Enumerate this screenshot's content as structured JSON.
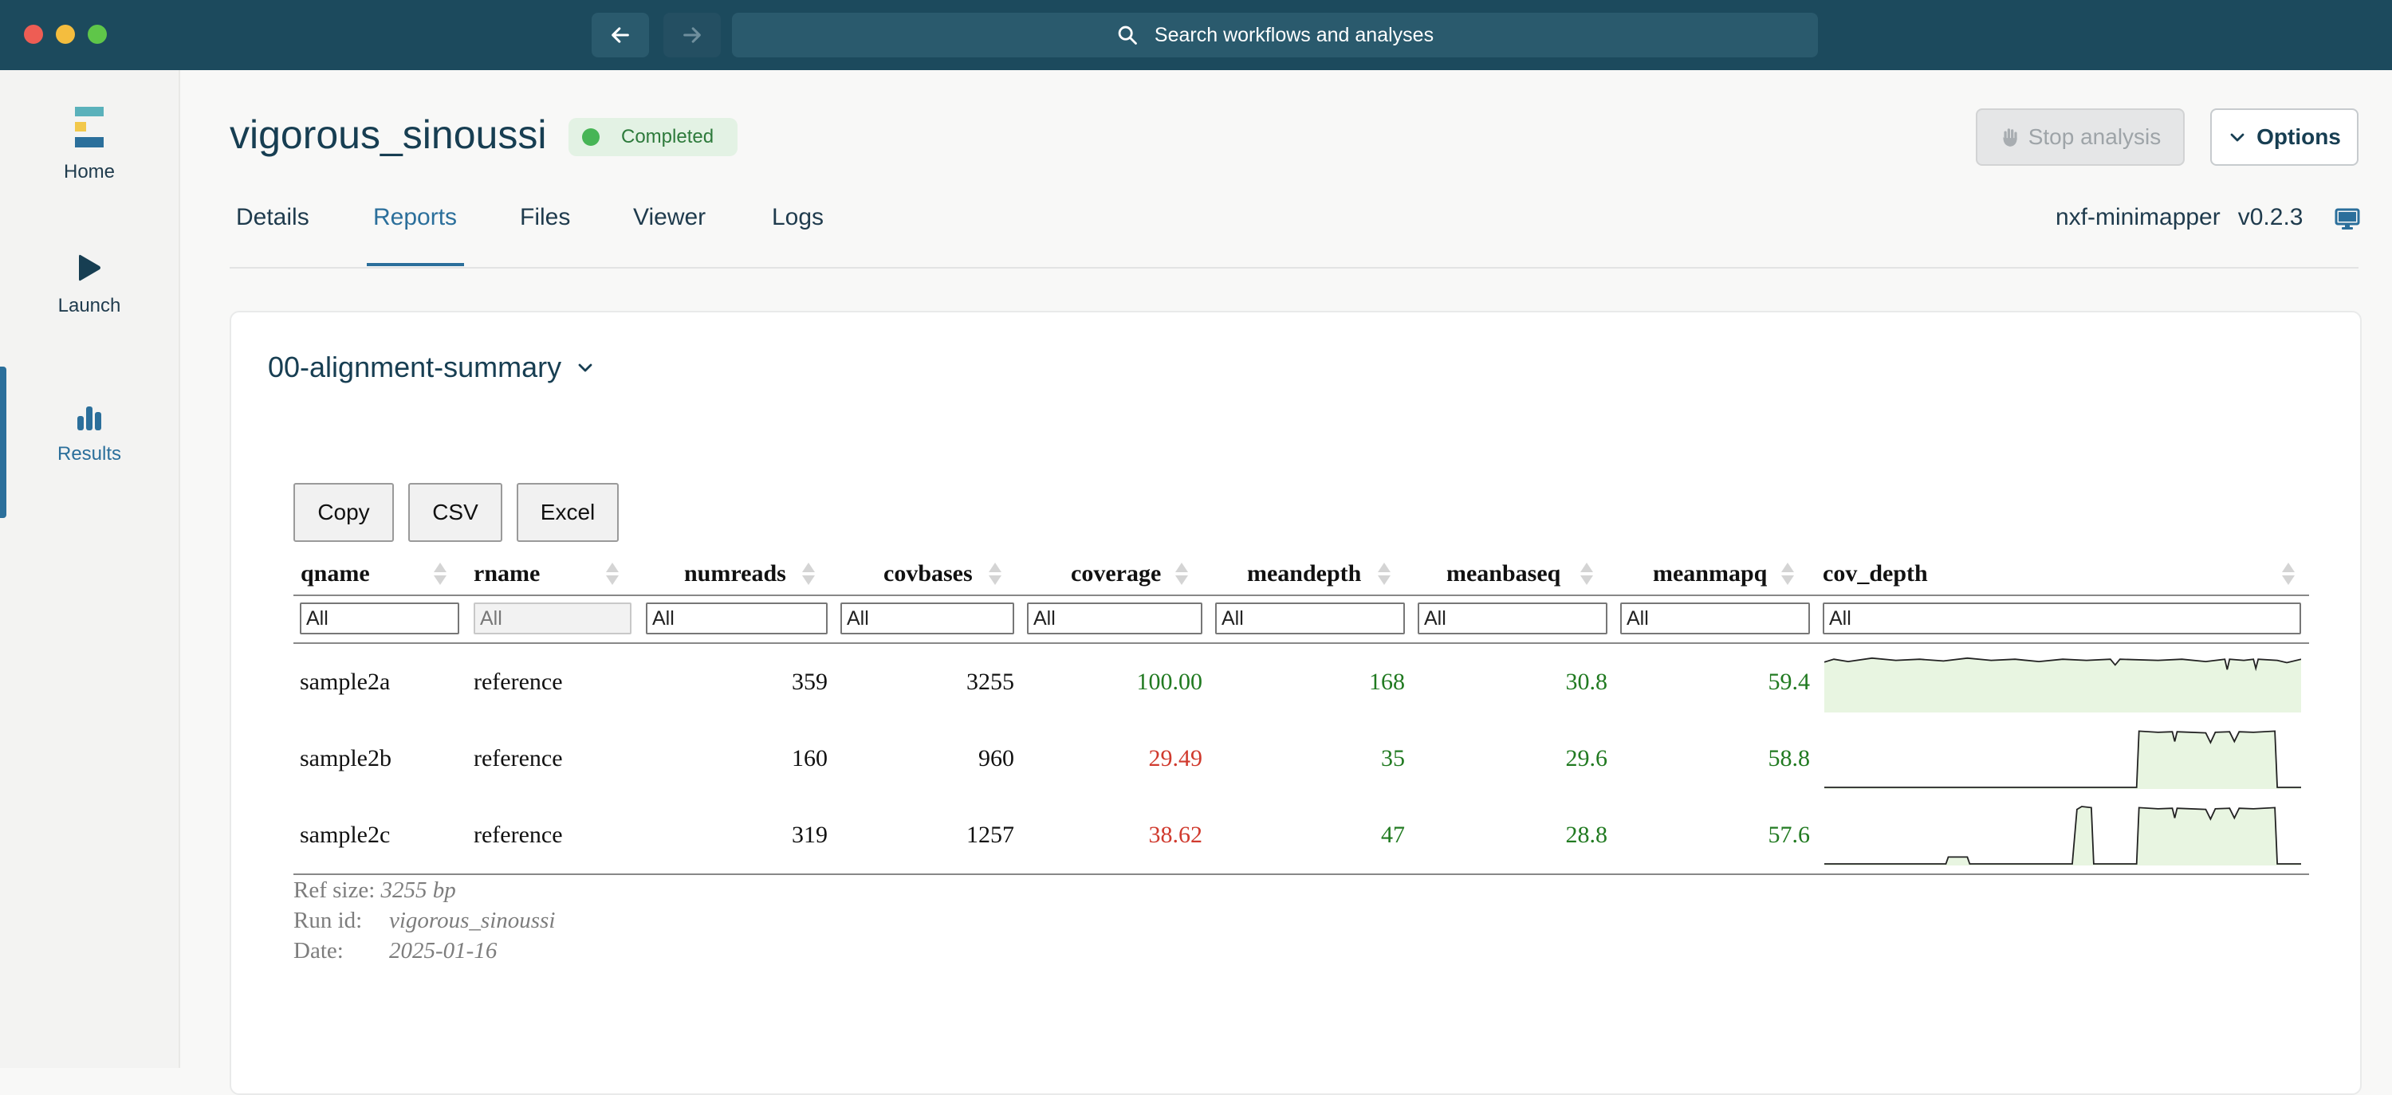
{
  "titlebar": {
    "search_placeholder": "Search workflows and analyses",
    "icons": {
      "back": "arrow-left-icon",
      "forward": "arrow-right-icon",
      "search": "search-icon"
    }
  },
  "sidebar": {
    "items": [
      {
        "label": "Home",
        "icon": "logo-icon"
      },
      {
        "label": "Launch",
        "icon": "play-icon"
      },
      {
        "label": "Results",
        "icon": "bar-chart-icon",
        "active": true
      }
    ]
  },
  "header": {
    "title": "vigorous_sinoussi",
    "status": "Completed",
    "stop_label": "Stop analysis",
    "options_label": "Options"
  },
  "tabs": [
    {
      "label": "Details"
    },
    {
      "label": "Reports",
      "active": true
    },
    {
      "label": "Files"
    },
    {
      "label": "Viewer"
    },
    {
      "label": "Logs"
    }
  ],
  "pipeline": {
    "name": "nxf-minimapper",
    "version": "v0.2.3"
  },
  "report": {
    "selected": "00-alignment-summary",
    "export_buttons": [
      "Copy",
      "CSV",
      "Excel"
    ],
    "columns": [
      "qname",
      "rname",
      "numreads",
      "covbases",
      "coverage",
      "meandepth",
      "meanbaseq",
      "meanmapq",
      "cov_depth"
    ],
    "filter_placeholder": "All",
    "rows": [
      {
        "qname": "sample2a",
        "rname": "reference",
        "numreads": "359",
        "covbases": "3255",
        "coverage": "100.00",
        "meandepth": "168",
        "meanbaseq": "30.8",
        "meanmapq": "59.4",
        "cov_depth": [
          [
            0,
            0.85
          ],
          [
            0.02,
            0.9
          ],
          [
            0.05,
            0.86
          ],
          [
            0.1,
            0.92
          ],
          [
            0.15,
            0.88
          ],
          [
            0.2,
            0.9
          ],
          [
            0.25,
            0.87
          ],
          [
            0.3,
            0.92
          ],
          [
            0.35,
            0.88
          ],
          [
            0.4,
            0.9
          ],
          [
            0.45,
            0.86
          ],
          [
            0.5,
            0.9
          ],
          [
            0.55,
            0.88
          ],
          [
            0.6,
            0.9
          ],
          [
            0.61,
            0.8
          ],
          [
            0.62,
            0.9
          ],
          [
            0.7,
            0.88
          ],
          [
            0.75,
            0.9
          ],
          [
            0.8,
            0.86
          ],
          [
            0.84,
            0.9
          ],
          [
            0.845,
            0.72
          ],
          [
            0.85,
            0.9
          ],
          [
            0.88,
            0.88
          ],
          [
            0.9,
            0.9
          ],
          [
            0.905,
            0.74
          ],
          [
            0.91,
            0.9
          ],
          [
            0.95,
            0.88
          ],
          [
            0.97,
            0.84
          ],
          [
            1,
            0.9
          ]
        ]
      },
      {
        "qname": "sample2b",
        "rname": "reference",
        "numreads": "160",
        "covbases": "960",
        "coverage": "29.49",
        "meandepth": "35",
        "meanbaseq": "29.6",
        "meanmapq": "58.8",
        "cov_depth": [
          [
            0,
            0
          ],
          [
            0.655,
            0
          ],
          [
            0.66,
            0.98
          ],
          [
            0.7,
            0.96
          ],
          [
            0.73,
            0.97
          ],
          [
            0.735,
            0.8
          ],
          [
            0.74,
            0.97
          ],
          [
            0.8,
            0.95
          ],
          [
            0.81,
            0.78
          ],
          [
            0.82,
            0.96
          ],
          [
            0.85,
            0.97
          ],
          [
            0.86,
            0.8
          ],
          [
            0.87,
            0.97
          ],
          [
            0.9,
            0.96
          ],
          [
            0.945,
            0.98
          ],
          [
            0.95,
            0
          ],
          [
            1,
            0
          ]
        ]
      },
      {
        "qname": "sample2c",
        "rname": "reference",
        "numreads": "319",
        "covbases": "1257",
        "coverage": "38.62",
        "meandepth": "47",
        "meanbaseq": "28.8",
        "meanmapq": "57.6",
        "cov_depth": [
          [
            0,
            0
          ],
          [
            0.255,
            0
          ],
          [
            0.26,
            0.12
          ],
          [
            0.3,
            0.12
          ],
          [
            0.305,
            0
          ],
          [
            0.52,
            0
          ],
          [
            0.53,
            0.95
          ],
          [
            0.54,
            1
          ],
          [
            0.56,
            0.98
          ],
          [
            0.565,
            0
          ],
          [
            0.655,
            0
          ],
          [
            0.66,
            0.98
          ],
          [
            0.7,
            0.96
          ],
          [
            0.73,
            0.97
          ],
          [
            0.735,
            0.8
          ],
          [
            0.74,
            0.97
          ],
          [
            0.8,
            0.95
          ],
          [
            0.81,
            0.78
          ],
          [
            0.82,
            0.96
          ],
          [
            0.85,
            0.97
          ],
          [
            0.86,
            0.8
          ],
          [
            0.87,
            0.97
          ],
          [
            0.9,
            0.96
          ],
          [
            0.945,
            0.98
          ],
          [
            0.95,
            0
          ],
          [
            1,
            0
          ]
        ]
      }
    ],
    "footer": {
      "ref_size_label": "Ref size:",
      "ref_size": "3255 bp",
      "run_id_label": "Run id:",
      "run_id": "vigorous_sinoussi",
      "date_label": "Date:",
      "date": "2025-01-16"
    },
    "colors": {
      "good": "#217a21",
      "bad": "#d03a2e",
      "spark_fill": "#e8f5e1"
    }
  }
}
